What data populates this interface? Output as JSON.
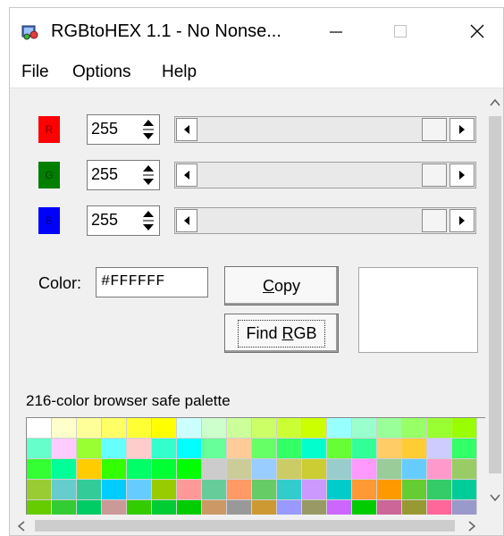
{
  "window": {
    "title": "RGBtoHEX 1.1 - No Nonse...",
    "icon": "rgbtohex-app-icon",
    "controls": {
      "minimize": "minimize-icon",
      "maximize": "maximize-icon",
      "close": "close-icon"
    }
  },
  "menu": {
    "items": [
      "File",
      "Options",
      "Help"
    ]
  },
  "channels": [
    {
      "label": "R",
      "value": "255",
      "color": "#ff0000",
      "label_color": "#800000",
      "slider_level": 1.0
    },
    {
      "label": "G",
      "value": "255",
      "color": "#007f00",
      "label_color": "#004000",
      "slider_level": 1.0
    },
    {
      "label": "B",
      "value": "255",
      "color": "#0000ff",
      "label_color": "#000080",
      "slider_level": 1.0
    }
  ],
  "color_field": {
    "label": "Color:",
    "value": "#FFFFFF"
  },
  "buttons": {
    "copy": {
      "underline": "C",
      "rest": "opy"
    },
    "find": {
      "before": "Find ",
      "underline": "R",
      "after": "GB"
    }
  },
  "preview": {
    "color": "#ffffff"
  },
  "palette": {
    "label": "216-color browser safe palette",
    "rows": [
      [
        "#ffffff",
        "#ffffcc",
        "#ffff99",
        "#ffff66",
        "#ffff33",
        "#ffff00",
        "#ccffff",
        "#ccffcc",
        "#ccff99",
        "#ccff66",
        "#ccff33",
        "#ccff00",
        "#99ffff",
        "#99ffcc",
        "#99ff99",
        "#99ff66",
        "#99ff33",
        "#99ff00"
      ],
      [
        "#66ffcc",
        "#ffccff",
        "#99ff33",
        "#66ffff",
        "#ffcccc",
        "#33ffcc",
        "#00ffff",
        "#66ff99",
        "#ffcc99",
        "#66ff66",
        "#33ff66",
        "#00ffcc",
        "#66ff33",
        "#33ff99",
        "#ffcc66",
        "#ffcc33",
        "#ccccff",
        "#33ff66"
      ],
      [
        "#33ff33",
        "#00ff99",
        "#ffcc00",
        "#33ff00",
        "#00ff66",
        "#00ff33",
        "#00ff00",
        "#cccccc",
        "#cccc99",
        "#99ccff",
        "#cccc66",
        "#cccc33",
        "#99cccc",
        "#ff99ff",
        "#99cc99",
        "#66ccff",
        "#ff99cc",
        "#99cc66"
      ],
      [
        "#99cc33",
        "#66cccc",
        "#33cc99",
        "#00ccff",
        "#66ccff",
        "#99cc00",
        "#ff9999",
        "#66cc99",
        "#ff9966",
        "#66cc66",
        "#33cccc",
        "#cc99ff",
        "#00cccc",
        "#ff9933",
        "#ff9900",
        "#66cc33",
        "#33cc66",
        "#00cc99"
      ],
      [
        "#66cc00",
        "#33cc33",
        "#00cc66",
        "#cc9999",
        "#33cc00",
        "#00cc33",
        "#00cc00",
        "#cc9966",
        "#999999",
        "#cc9933",
        "#9999ff",
        "#999966",
        "#cc66ff",
        "#00cc00",
        "#cc6699",
        "#999933",
        "#ff6699",
        "#9999cc"
      ]
    ]
  },
  "scroll": {
    "up": "scroll-up-arrow-icon",
    "down": "scroll-down-arrow-icon",
    "left": "scroll-left-arrow-icon",
    "right": "scroll-right-arrow-icon"
  }
}
